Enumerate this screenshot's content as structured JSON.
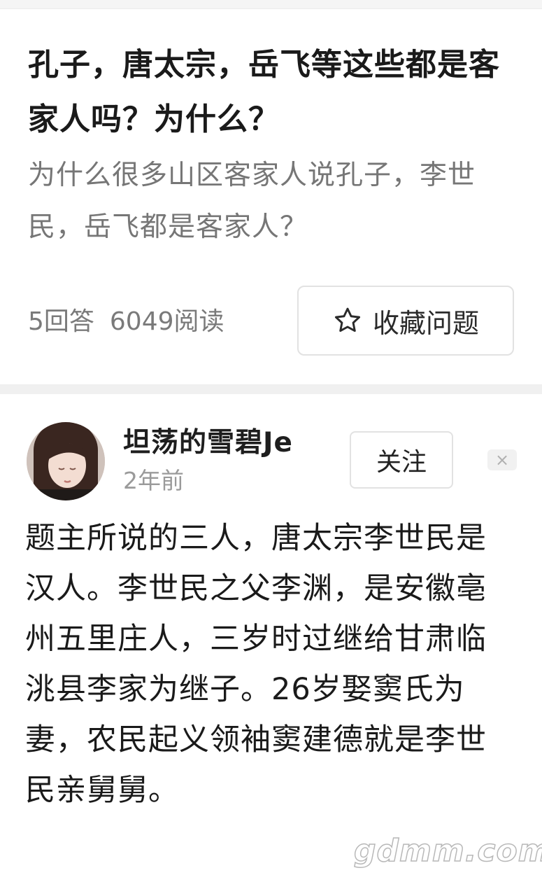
{
  "question": {
    "title": "孔子，唐太宗，岳飞等这些都是客家人吗？为什么？",
    "description": "为什么很多山区客家人说孔子，李世民，岳飞都是客家人？",
    "answers_count": "5回答",
    "read_count": "6049阅读",
    "favorite_label": "收藏问题"
  },
  "answer": {
    "author_name": "坦荡的雪碧Je",
    "time": "2年前",
    "follow_label": "关注",
    "close_symbol": "×",
    "paragraphs": [
      "题主所说的三人，唐太宗李世民是汉人。李世民之父李渊，是安徽亳州五里庄人，三岁时过继给甘肃临洮县李家为继子。26岁娶窦氏为妻，农民起义领袖窦建德就是李世民亲舅舅。"
    ]
  },
  "watermark": "gdmm.com",
  "icons": {
    "favorite": "star-outline-icon",
    "close": "close-icon"
  },
  "colors": {
    "title": "#1a1a1a",
    "description": "#767676",
    "meta": "#7a7a7a",
    "divider": "#f0f0f0"
  }
}
